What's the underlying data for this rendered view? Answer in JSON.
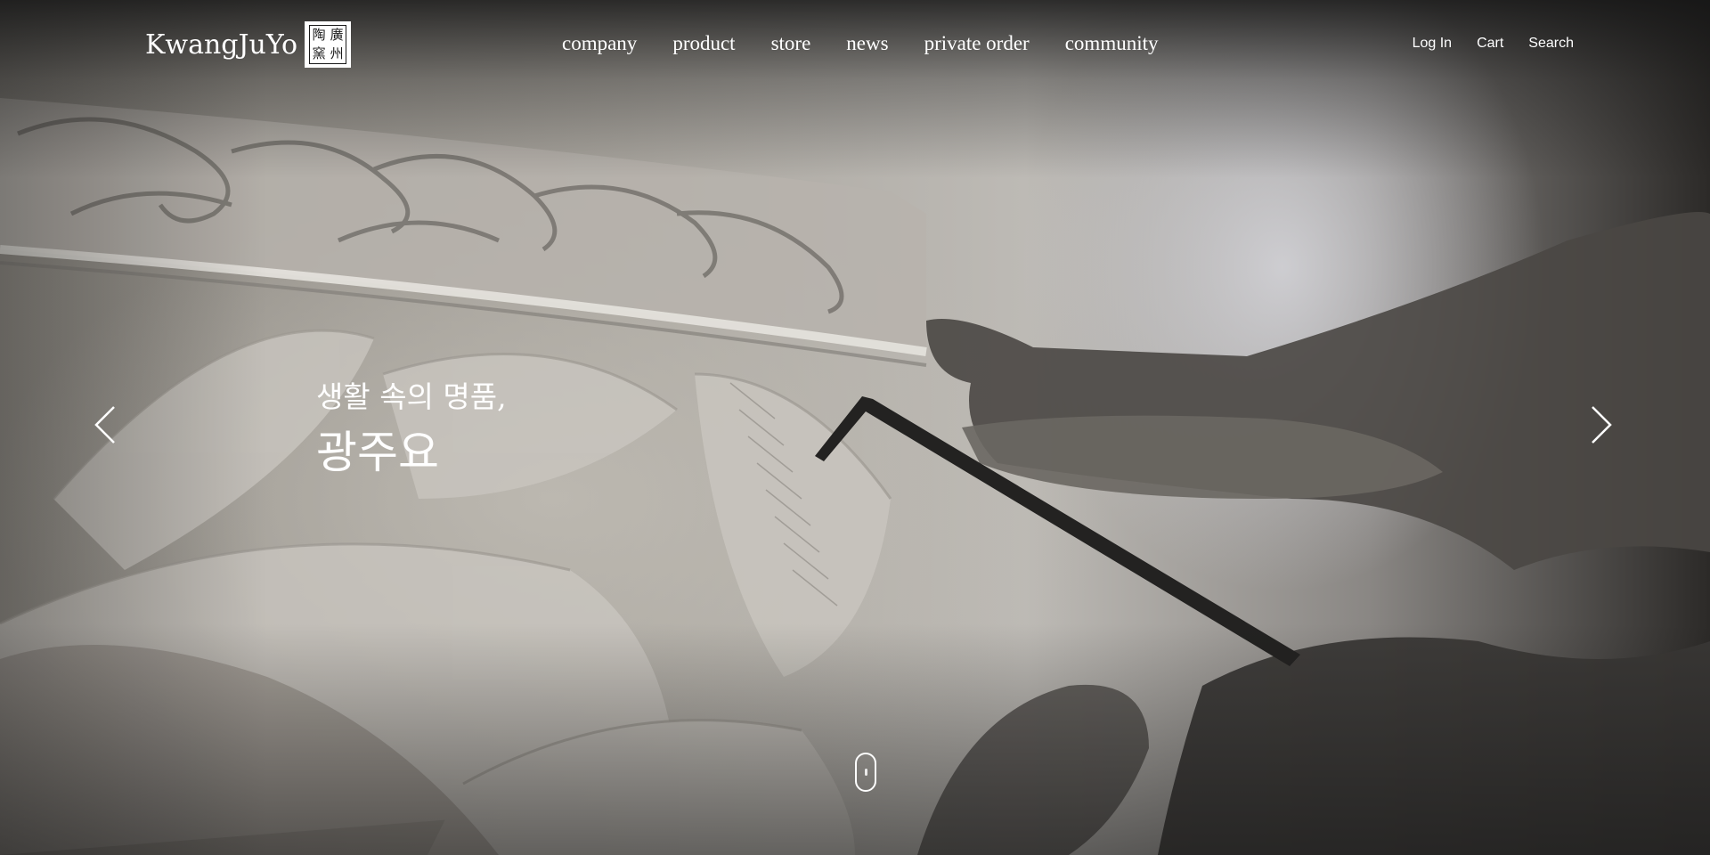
{
  "brand": {
    "name": "KwangJuYo",
    "seal_chars": [
      "陶",
      "廣",
      "窯",
      "州"
    ],
    "seal_alt": "KwangJuYo seal logo"
  },
  "nav": {
    "main": [
      {
        "label": "company"
      },
      {
        "label": "product"
      },
      {
        "label": "store"
      },
      {
        "label": "news"
      },
      {
        "label": "private order"
      },
      {
        "label": "community"
      }
    ],
    "utility": [
      {
        "label": "Log In"
      },
      {
        "label": "Cart"
      },
      {
        "label": "Search"
      }
    ]
  },
  "hero": {
    "line1": "생활 속의 명품,",
    "line2": "광주요",
    "image_subject": "craftsman carving a lotus relief on white porcelain",
    "prev_icon": "chevron-left-icon",
    "next_icon": "chevron-right-icon",
    "scroll_icon": "mouse-scroll-icon"
  },
  "colors": {
    "text": "#ffffff",
    "overlay": "#1a1a1a"
  }
}
